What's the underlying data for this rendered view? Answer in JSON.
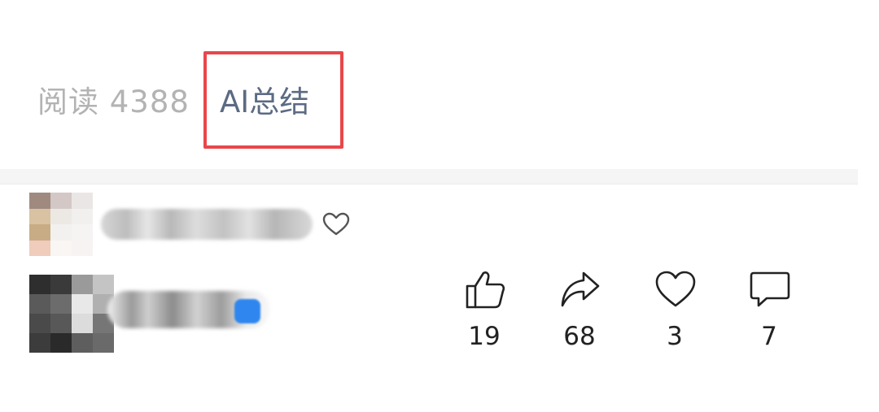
{
  "info": {
    "read_label": "阅读 4388",
    "ai_summary_label": "AI总结"
  },
  "actions": {
    "like_count": "19",
    "share_count": "68",
    "favorite_count": "3",
    "comment_count": "7"
  },
  "colors": {
    "highlight_border": "#e8474a",
    "ai_text": "#5b6b84",
    "muted_text": "#b3b3b3",
    "count_text": "#222222",
    "verified_badge": "#2f86ee"
  },
  "icons": [
    "heart-outline-icon",
    "thumbs-up-icon",
    "share-arrow-icon",
    "heart-icon",
    "comment-bubble-icon",
    "verified-badge-icon"
  ]
}
